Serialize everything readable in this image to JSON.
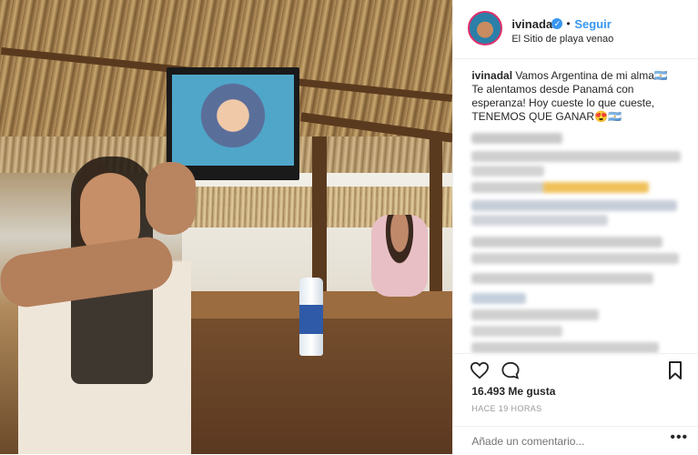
{
  "header": {
    "username": "ivinadal",
    "verified_icon": "verified-badge-icon",
    "separator": "•",
    "follow_label": "Seguir",
    "location": "El Sitio de playa venao"
  },
  "caption": {
    "username": "ivinadal",
    "line1": "Vamos Argentina de mi alma🇦🇷",
    "line2": "Te alentamos desde Panamá con",
    "line3": "esperanza! Hoy cueste lo que cueste,",
    "line4": "TENEMOS QUE GANAR😍🇦🇷"
  },
  "actions": {
    "like_icon": "heart-icon",
    "comment_icon": "comment-icon",
    "save_icon": "bookmark-icon"
  },
  "likes": "16.493 Me gusta",
  "timestamp": "HACE 19 HORAS",
  "comment_input": {
    "placeholder": "Añade un comentario...",
    "more_label": "•••"
  },
  "colors": {
    "link_blue": "#3897f0",
    "text_primary": "#262626",
    "text_secondary": "#999999",
    "avatar_ring": "#e1306c"
  }
}
